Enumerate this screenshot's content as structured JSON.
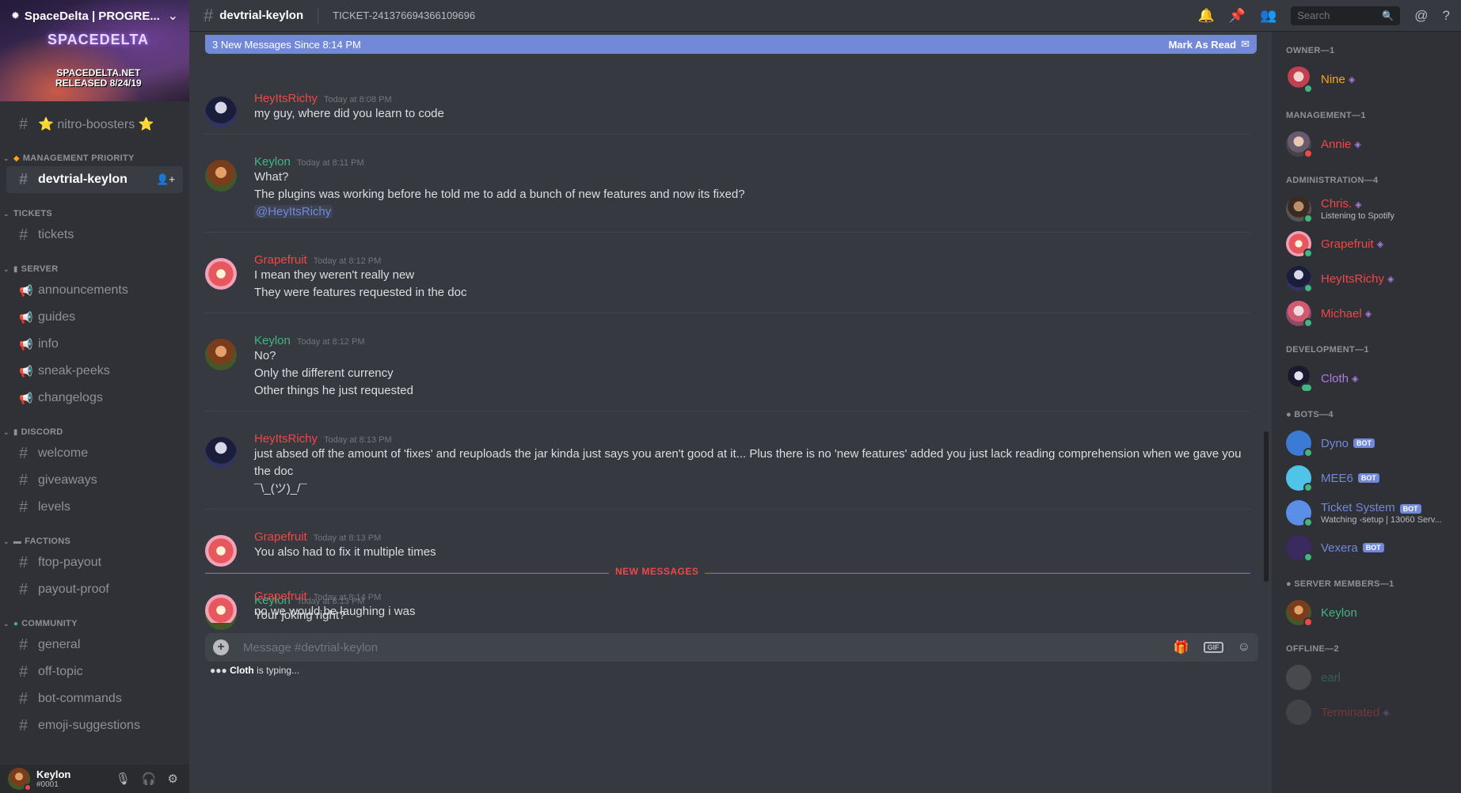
{
  "server": {
    "name": "SpaceDelta | PROGRE...",
    "banner_logo": "SPACEDELTA",
    "banner_text_1": "SPACEDELTA.NET",
    "banner_text_2": "RELEASED 8/24/19"
  },
  "sidebar": {
    "top_channel": "⭐ nitro-boosters ⭐",
    "cat_mgmt": "MANAGEMENT PRIORITY",
    "active_channel": "devtrial-keylon",
    "cat_tickets": "TICKETS",
    "ch_tickets": "tickets",
    "cat_server": "SERVER",
    "ch_announcements": "announcements",
    "ch_guides": "guides",
    "ch_info": "info",
    "ch_sneak": "sneak-peeks",
    "ch_changelogs": "changelogs",
    "cat_discord": "DISCORD",
    "ch_welcome": "welcome",
    "ch_giveaways": "giveaways",
    "ch_levels": "levels",
    "cat_factions": "FACTIONS",
    "ch_ftop": "ftop-payout",
    "ch_payout": "payout-proof",
    "cat_community": "COMMUNITY",
    "ch_general": "general",
    "ch_offtopic": "off-topic",
    "ch_botcmds": "bot-commands",
    "ch_emoji": "emoji-suggestions"
  },
  "user": {
    "name": "Keylon",
    "tag": "#0001"
  },
  "header": {
    "channel": "devtrial-keylon",
    "topic": "TICKET-241376694366109696",
    "search_placeholder": "Search"
  },
  "chat": {
    "new_bar": "3 New Messages Since 8:14 PM",
    "mark_read": "Mark As Read",
    "divider": "NEW MESSAGES",
    "input_placeholder": "Message #devtrial-keylon",
    "typing_user": "Cloth",
    "typing_suffix": " is typing..."
  },
  "messages": [
    {
      "author": "HeyItsRichy",
      "time": "Today at 8:08 PM",
      "lines": [
        "my guy, where did you learn to code"
      ]
    },
    {
      "author": "Keylon",
      "time": "Today at 8:11 PM",
      "lines": [
        "What?",
        "The plugins was working before he told me to add a bunch of new features and now its fixed?"
      ],
      "mention": "@HeyItsRichy"
    },
    {
      "author": "Grapefruit",
      "time": "Today at 8:12 PM",
      "lines": [
        "I mean they weren't really new",
        "They were features requested in the doc"
      ]
    },
    {
      "author": "Keylon",
      "time": "Today at 8:12 PM",
      "lines": [
        "No?",
        "Only the different currency",
        "Other things he just requested"
      ]
    },
    {
      "author": "HeyItsRichy",
      "time": "Today at 8:13 PM",
      "lines": [
        "just absed off the amount of 'fixes' and reuploads the jar kinda just says you aren't good at it... Plus there is no 'new features' added you just lack reading comprehension when we gave you",
        "the doc",
        "¯\\_(ツ)_/¯"
      ]
    },
    {
      "author": "Grapefruit",
      "time": "Today at 8:13 PM",
      "lines": [
        "You also had to fix it multiple times"
      ]
    },
    {
      "author": "Keylon",
      "time": "Today at 8:13 PM",
      "lines": [
        "Your joking right?"
      ]
    },
    {
      "author": "Grapefruit",
      "time": "Today at 8:14 PM",
      "lines": [
        "no we would be laughing i was"
      ]
    }
  ],
  "members": {
    "g_owner": "OWNER—1",
    "nine": "Nine",
    "g_mgmt": "MANAGEMENT—1",
    "annie": "Annie",
    "g_admin": "ADMINISTRATION—4",
    "chris": "Chris.",
    "chris_status": "Listening to Spotify",
    "grapefruit": "Grapefruit",
    "richy": "HeyItsRichy",
    "michael": "Michael",
    "g_dev": "DEVELOPMENT—1",
    "cloth": "Cloth",
    "g_bots": "● BOTS—4",
    "dyno": "Dyno",
    "mee6": "MEE6",
    "ticket": "Ticket System",
    "ticket_status": "Watching -setup | 13060 Serv...",
    "vexera": "Vexera",
    "bot_tag": "BOT",
    "g_members": "● SERVER MEMBERS—1",
    "keylon": "Keylon",
    "g_offline": "OFFLINE—2",
    "earl": "earl",
    "terminated": "Terminated"
  },
  "colors": {
    "accent": "#7289da",
    "danger": "#f04747",
    "online": "#43b581"
  }
}
